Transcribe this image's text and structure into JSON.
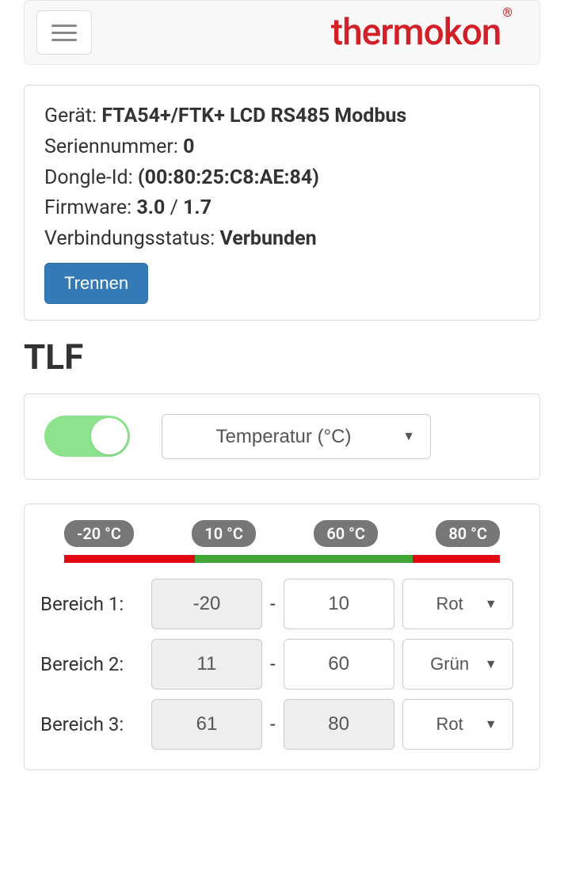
{
  "logo_text": "thermokon",
  "logo_reg": "®",
  "info": {
    "device_label": "Gerät: ",
    "device_value": "FTA54+/FTK+ LCD RS485 Modbus",
    "serial_label": "Seriennummer: ",
    "serial_value": "0",
    "dongle_label": "Dongle-Id: ",
    "dongle_value": "(00:80:25:C8:AE:84)",
    "firmware_label": "Firmware: ",
    "firmware_value1": "3.0",
    "firmware_sep": " / ",
    "firmware_value2": "1.7",
    "conn_label": "Verbindungsstatus: ",
    "conn_value": "Verbunden",
    "disconnect_btn": "Trennen"
  },
  "section_title": "TLF",
  "measure_select": "Temperatur (°C)",
  "badges": [
    "-20 °C",
    "10 °C",
    "60 °C",
    "80 °C"
  ],
  "ranges": [
    {
      "label": "Bereich 1:",
      "min": "-20",
      "max": "10",
      "color": "Rot",
      "min_disabled": true,
      "max_disabled": false
    },
    {
      "label": "Bereich 2:",
      "min": "11",
      "max": "60",
      "color": "Grün",
      "min_disabled": true,
      "max_disabled": false
    },
    {
      "label": "Bereich 3:",
      "min": "61",
      "max": "80",
      "color": "Rot",
      "min_disabled": true,
      "max_disabled": true
    }
  ],
  "dash": "-"
}
